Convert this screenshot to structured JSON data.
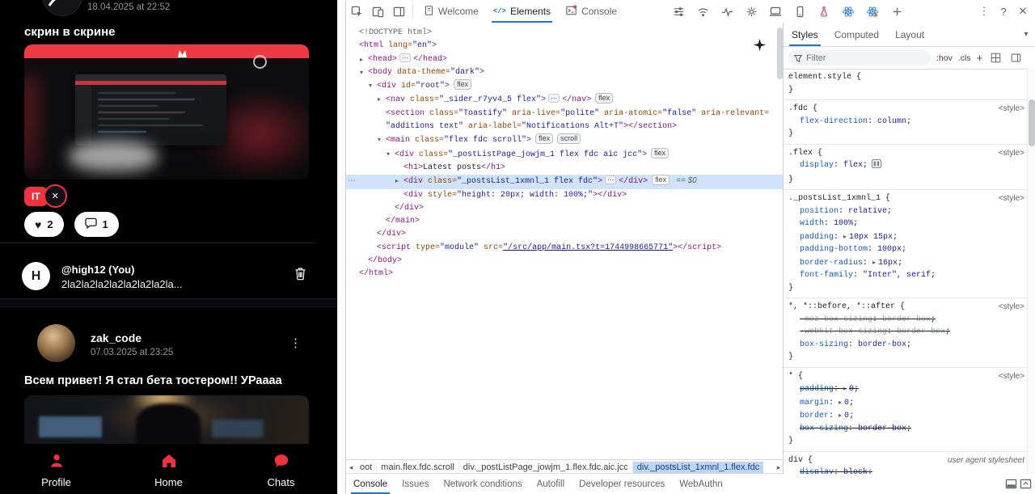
{
  "colors": {
    "app_accent": "#f0323f",
    "devtools_accent": "#1a73e8",
    "selected_line_bg": "#cfe3fc"
  },
  "icons": {
    "close": "✕",
    "kebab": "⋮",
    "help": "?",
    "chevron_down": "▾",
    "heart": "♥",
    "crumb_left": "◂",
    "crumb_right": "▸",
    "post_kebab": "⋮"
  },
  "app": {
    "top_post": {
      "date": "18.04.2025 at 22:52",
      "title": "скрин в скрине",
      "tag": "IT",
      "likes": "2",
      "comments": "1"
    },
    "comment_row": {
      "avatar_letter": "H",
      "author": "@high12 (You)",
      "preview": "2la2la2la2la2la2la2la2la..."
    },
    "post2": {
      "author": "zak_code",
      "date": "07.03.2025 at 23:25",
      "title": "Всем привет! Я стал бета тостером!! УРаааа"
    },
    "nav_items": [
      {
        "id": "profile",
        "label": "Profile"
      },
      {
        "id": "home",
        "label": "Home"
      },
      {
        "id": "chats",
        "label": "Chats"
      }
    ]
  },
  "devtools": {
    "toolbar_left_icons": [
      "inspect",
      "device-toolbar",
      "dock-side"
    ],
    "main_tabs": [
      {
        "id": "welcome",
        "label": "Welcome",
        "selected": false
      },
      {
        "id": "elements",
        "label": "Elements",
        "selected": true
      },
      {
        "id": "console",
        "label": "Console",
        "selected": false
      }
    ],
    "toolbar_cluster_icons": [
      "tune",
      "wifi",
      "performance",
      "settings",
      "laptop",
      "tablet",
      "extension-pink",
      "react-components",
      "react-profiler",
      "add-panel"
    ],
    "tree": [
      {
        "i": 0,
        "p": [
          [
            "d",
            "<!DOCTYPE html>"
          ]
        ]
      },
      {
        "i": 0,
        "p": [
          [
            "t",
            "<html"
          ],
          [
            "a",
            " lang="
          ],
          [
            "v",
            "\"en\""
          ],
          [
            "t",
            ">"
          ]
        ]
      },
      {
        "i": 1,
        "a": "▸",
        "p": [
          [
            "t",
            "<head>"
          ],
          [
            "e",
            "⋯"
          ],
          [
            "t",
            "</head>"
          ]
        ]
      },
      {
        "i": 1,
        "a": "▾",
        "p": [
          [
            "t",
            "<body"
          ],
          [
            "a",
            " data-theme="
          ],
          [
            "v",
            "\"dark\""
          ],
          [
            "t",
            ">"
          ]
        ]
      },
      {
        "i": 2,
        "a": "▾",
        "p": [
          [
            "t",
            "<div"
          ],
          [
            "a",
            " id="
          ],
          [
            "v",
            "\"root\""
          ],
          [
            "t",
            ">"
          ],
          [
            "b",
            "flex"
          ]
        ]
      },
      {
        "i": 3,
        "a": "▸",
        "p": [
          [
            "t",
            "<nav"
          ],
          [
            "a",
            " class="
          ],
          [
            "v",
            "\"_sider_r7yv4_5 flex\""
          ],
          [
            "t",
            ">"
          ],
          [
            "e",
            "⋯"
          ],
          [
            "t",
            "</nav>"
          ],
          [
            "b",
            "flex"
          ]
        ]
      },
      {
        "i": 3,
        "p": [
          [
            "t",
            "<section"
          ],
          [
            "a",
            " class="
          ],
          [
            "v",
            "\"Toastify\""
          ],
          [
            "a",
            " aria-live="
          ],
          [
            "v",
            "\"polite\""
          ],
          [
            "a",
            " aria-atomic="
          ],
          [
            "v",
            "\"false\""
          ],
          [
            "a",
            " aria-relevant="
          ]
        ]
      },
      {
        "i": 3,
        "p": [
          [
            "v",
            "\"additions text\""
          ],
          [
            "a",
            " aria-label="
          ],
          [
            "v",
            "\"Notifications Alt+T\""
          ],
          [
            "t",
            "></section>"
          ]
        ]
      },
      {
        "i": 3,
        "a": "▾",
        "p": [
          [
            "t",
            "<main"
          ],
          [
            "a",
            " class="
          ],
          [
            "v",
            "\"flex fdc scroll\""
          ],
          [
            "t",
            ">"
          ],
          [
            "b",
            "flex"
          ],
          [
            "b",
            "scroll"
          ]
        ]
      },
      {
        "i": 4,
        "a": "▾",
        "p": [
          [
            "t",
            "<div"
          ],
          [
            "a",
            " class="
          ],
          [
            "v",
            "\"_postListPage_jowjm_1 flex fdc aic jcc\""
          ],
          [
            "t",
            ">"
          ],
          [
            "b",
            "flex"
          ]
        ]
      },
      {
        "i": 5,
        "p": [
          [
            "t",
            "<h1>"
          ],
          [
            "x",
            "Latest posts"
          ],
          [
            "t",
            "</h1>"
          ]
        ]
      },
      {
        "i": 5,
        "a": "▸",
        "sel": true,
        "g": true,
        "p": [
          [
            "t",
            "<div"
          ],
          [
            "a",
            " class="
          ],
          [
            "v",
            "\"_postsList_1xmnl_1 flex fdc\""
          ],
          [
            "t",
            ">"
          ],
          [
            "e",
            "⋯"
          ],
          [
            "t",
            "</div>"
          ],
          [
            "b",
            "flex"
          ],
          [
            "s",
            "== $0"
          ]
        ]
      },
      {
        "i": 5,
        "p": [
          [
            "t",
            "<div"
          ],
          [
            "a",
            " style="
          ],
          [
            "v",
            "\"height: 20px; width: 100%;\""
          ],
          [
            "t",
            "></div>"
          ]
        ]
      },
      {
        "i": 4,
        "p": [
          [
            "t",
            "</div>"
          ]
        ]
      },
      {
        "i": 3,
        "p": [
          [
            "t",
            "</main>"
          ]
        ]
      },
      {
        "i": 2,
        "p": [
          [
            "t",
            "</div>"
          ]
        ]
      },
      {
        "i": 2,
        "p": [
          [
            "t",
            "<script"
          ],
          [
            "a",
            " type="
          ],
          [
            "v",
            "\"module\""
          ],
          [
            "a",
            " src="
          ],
          [
            "l",
            "\"/src/app/main.tsx?t=1744998665771\""
          ],
          [
            "t",
            "></script>"
          ]
        ]
      },
      {
        "i": 1,
        "p": [
          [
            "t",
            "</body>"
          ]
        ]
      },
      {
        "i": 0,
        "p": [
          [
            "t",
            "</html>"
          ]
        ]
      }
    ],
    "breadcrumbs": [
      {
        "label": "oot",
        "selected": false
      },
      {
        "label": "main.flex.fdc.scroll",
        "selected": false
      },
      {
        "label": "div._postListPage_jowjm_1.flex.fdc.aic.jcc",
        "selected": false
      },
      {
        "label": "div._postsList_1xmnl_1.flex.fdc",
        "selected": true
      }
    ],
    "drawer_tabs": [
      {
        "label": "Console",
        "selected": true
      },
      {
        "label": "Issues",
        "selected": false
      },
      {
        "label": "Network conditions",
        "selected": false
      },
      {
        "label": "Autofill",
        "selected": false
      },
      {
        "label": "Developer resources",
        "selected": false
      },
      {
        "label": "WebAuthn",
        "selected": false
      }
    ],
    "styles_panel": {
      "tabs": [
        {
          "label": "Styles",
          "selected": true
        },
        {
          "label": "Computed",
          "selected": false
        },
        {
          "label": "Layout",
          "selected": false
        }
      ],
      "filter_placeholder": "Filter",
      "pseudo_toggle": ":hov",
      "class_toggle": ".cls",
      "new_rule": "+",
      "rules": [
        {
          "selector": "element.style",
          "props": []
        },
        {
          "selector": ".fdc",
          "link": "<style>",
          "props": [
            {
              "n": "flex-direction",
              "v": "column"
            }
          ]
        },
        {
          "selector": ".flex",
          "link": "<style>",
          "props": [
            {
              "n": "display",
              "v": "flex",
              "flex_editor": true
            }
          ]
        },
        {
          "selector": "._postsList_1xmnl_1",
          "link": "<style>",
          "props": [
            {
              "n": "position",
              "v": "relative"
            },
            {
              "n": "width",
              "v": "100%"
            },
            {
              "n": "padding",
              "v": "10px 15px",
              "arrow": true
            },
            {
              "n": "padding-bottom",
              "v": "100px"
            },
            {
              "n": "border-radius",
              "v": "16px",
              "arrow": true
            },
            {
              "n": "font-family",
              "v": "\"Inter\", serif"
            }
          ]
        },
        {
          "selector": "*, *::before, *::after",
          "link": "<style>",
          "props": [
            {
              "n": "-moz-box-sizing",
              "v": "border-box",
              "struck": true,
              "dim": true
            },
            {
              "n": "-webkit-box-sizing",
              "v": "border-box",
              "struck": true,
              "dim": true
            },
            {
              "n": "box-sizing",
              "v": "border-box"
            }
          ]
        },
        {
          "selector": "*",
          "link": "<style>",
          "props": [
            {
              "n": "padding",
              "v": "0",
              "arrow": true,
              "struck": true
            },
            {
              "n": "margin",
              "v": "0",
              "arrow": true
            },
            {
              "n": "border",
              "v": "0",
              "arrow": true
            },
            {
              "n": "box-sizing",
              "v": "border-box",
              "struck": true
            }
          ]
        },
        {
          "selector": "div",
          "link": "user agent stylesheet",
          "uas": true,
          "props": [
            {
              "n": "display",
              "v": "block",
              "struck": true
            }
          ]
        }
      ]
    }
  }
}
